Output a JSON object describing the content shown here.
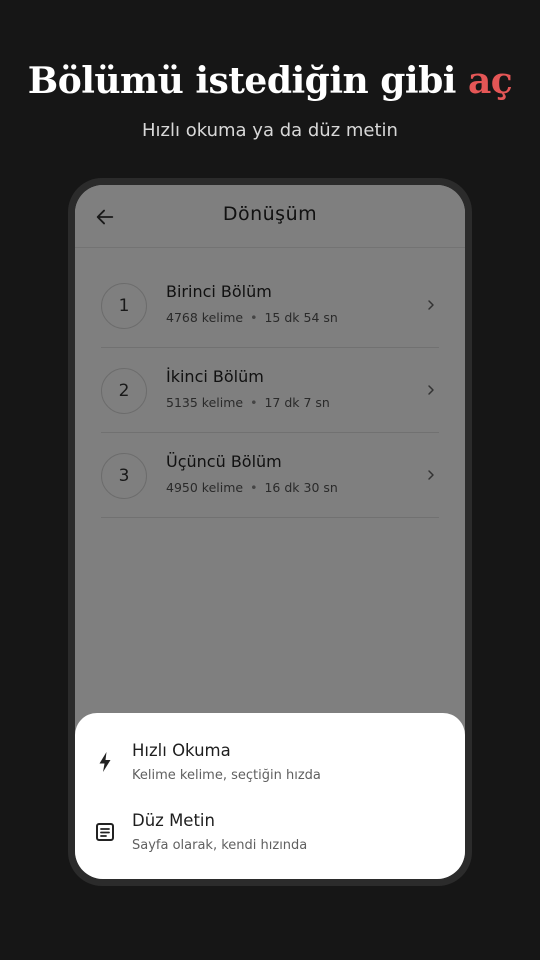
{
  "headline": {
    "main": "Bölümü istediğin gibi ",
    "accent": "aç",
    "accent_color": "#e55656"
  },
  "subheadline": "Hızlı okuma ya da düz metin",
  "app_bar": {
    "title": "Dönüşüm",
    "back_icon": "arrow-left-icon"
  },
  "chapters": [
    {
      "number": "1",
      "title": "Birinci Bölüm",
      "words": "4768 kelime",
      "duration": "15 dk 54 sn"
    },
    {
      "number": "2",
      "title": "İkinci Bölüm",
      "words": "5135 kelime",
      "duration": "17 dk 7 sn"
    },
    {
      "number": "3",
      "title": "Üçüncü Bölüm",
      "words": "4950 kelime",
      "duration": "16 dk 30 sn"
    }
  ],
  "sheet": {
    "options": [
      {
        "icon": "lightning-icon",
        "title": "Hızlı Okuma",
        "subtitle": "Kelime kelime, seçtiğin hızda"
      },
      {
        "icon": "document-icon",
        "title": "Düz Metin",
        "subtitle": "Sayfa olarak, kendi hızında"
      }
    ]
  }
}
